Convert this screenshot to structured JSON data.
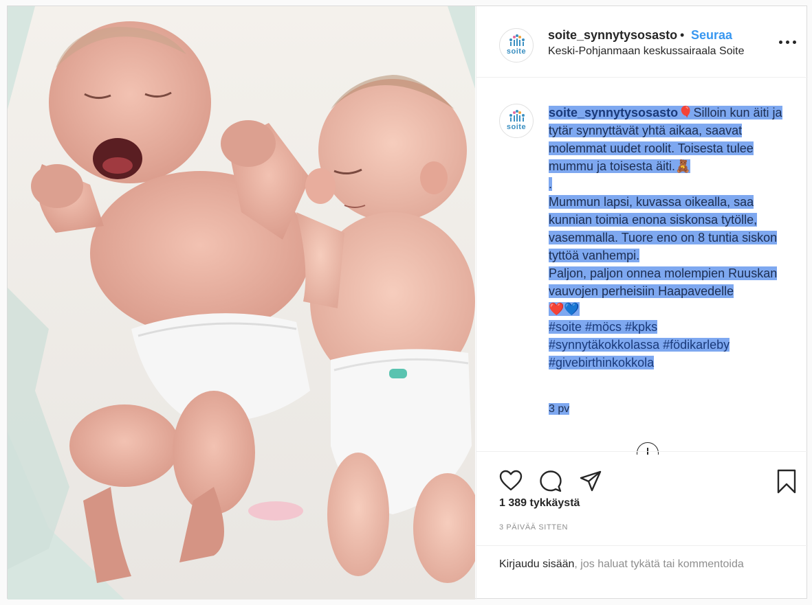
{
  "post": {
    "username": "soite_synnytysosasto",
    "separator": "•",
    "follow_label": "Seuraa",
    "location": "Keski-Pohjanmaan keskussairaala Soite",
    "avatar_text": "soite",
    "more_icon": "more-horizontal-icon"
  },
  "caption": {
    "username": "soite_synnytysosasto",
    "balloon_emoji": "🎈",
    "part1": "Silloin kun äiti ja tytär synnyttävät yhtä aikaa, saavat molemmat uudet roolit. Toisesta tulee mummu ja toisesta äiti.",
    "bear_emoji": "🧸",
    "dot": ".",
    "part2": "Mummun lapsi, kuvassa oikealla, saa kunnian toimia enona siskonsa tytölle, vasemmalla. Tuore eno on 8 tuntia siskon tyttöä vanhempi.",
    "part3": "Paljon, paljon onnea molempien Ruuskan vauvojen perheisiin Haapavedelle",
    "hearts": "❤️💙",
    "hashtags_line1": "#soite #möcs #kpks",
    "hashtags_line2": "#synnytäkokkolassa #födikarleby",
    "hashtags_line3": "#givebirthinkokkola",
    "time_ago": "3 pv"
  },
  "actions": {
    "like_icon": "heart-icon",
    "comment_icon": "comment-icon",
    "share_icon": "send-icon",
    "save_icon": "bookmark-icon",
    "likes": "1 389 tykkäystä",
    "date": "3 PÄIVÄÄ SITTEN",
    "login_link": "Kirjaudu sisään",
    "login_rest": ", jos haluat tykätä tai kommentoida"
  },
  "colors": {
    "selection": "#7ea8f0",
    "link_blue": "#3897f0",
    "text": "#262626",
    "muted": "#8e8e8e"
  }
}
